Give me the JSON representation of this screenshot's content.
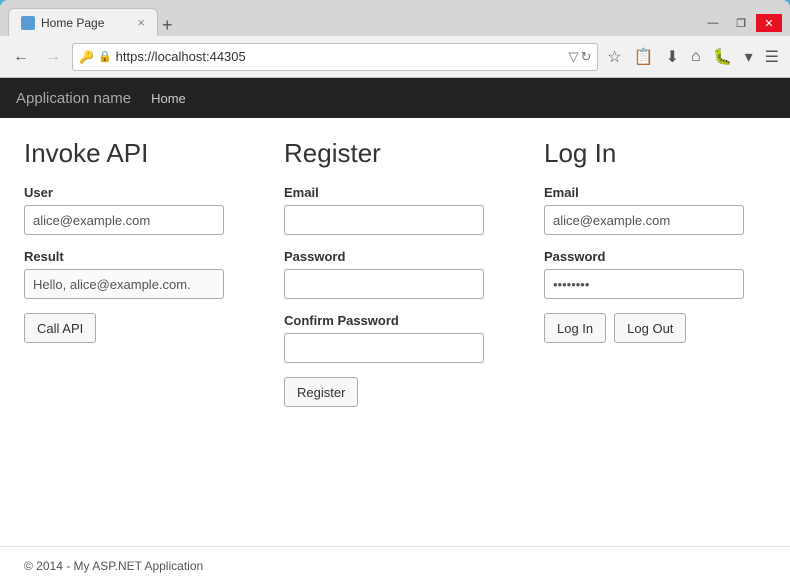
{
  "browser": {
    "tab_title": "Home Page",
    "tab_close": "×",
    "new_tab": "+",
    "address": "https://localhost:44305",
    "win_minimize": "—",
    "win_restore": "❐",
    "win_close": "✕"
  },
  "navbar": {
    "brand": "Application name",
    "home_link": "Home"
  },
  "invoke_api": {
    "title": "Invoke API",
    "user_label": "User",
    "user_value": "alice@example.com",
    "result_label": "Result",
    "result_value": "Hello, alice@example.com.",
    "call_api_btn": "Call API"
  },
  "register": {
    "title": "Register",
    "email_label": "Email",
    "email_placeholder": "",
    "password_label": "Password",
    "password_placeholder": "",
    "confirm_label": "Confirm Password",
    "confirm_placeholder": "",
    "register_btn": "Register"
  },
  "login": {
    "title": "Log In",
    "email_label": "Email",
    "email_value": "alice@example.com",
    "password_label": "Password",
    "password_value": "••••••••",
    "login_btn": "Log In",
    "logout_btn": "Log Out"
  },
  "footer": {
    "text": "© 2014 - My ASP.NET Application"
  }
}
